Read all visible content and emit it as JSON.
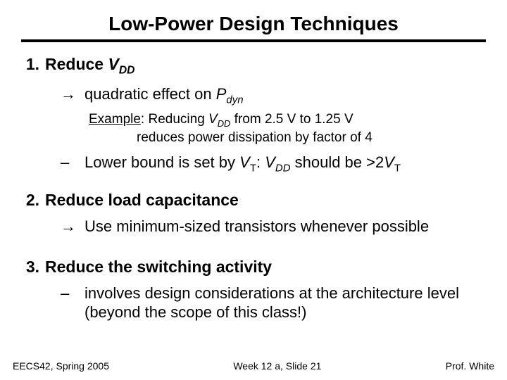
{
  "title": "Low-Power Design Techniques",
  "item1_num": "1.",
  "item1_a": "Reduce ",
  "item1_V": "V",
  "item1_DD": "DD",
  "item1_sub1_arrow": "→",
  "item1_sub1_a": "quadratic effect on ",
  "item1_sub1_P": "P",
  "item1_sub1_dyn": "dyn",
  "ex_label": "Example",
  "ex_a": ": Reducing ",
  "ex_V": "V",
  "ex_DD": "DD",
  "ex_b": " from 2.5 V to 1.25 V",
  "ex_line2": "reduces power dissipation by factor of 4",
  "item1_sub2_dash": "–",
  "item1_sub2_a": "Lower bound is set by ",
  "item1_sub2_V1": "V",
  "item1_sub2_T1": "T",
  "item1_sub2_b": ": ",
  "item1_sub2_V2": "V",
  "item1_sub2_DD": "DD",
  "item1_sub2_c": " should be >2",
  "item1_sub2_V3": "V",
  "item1_sub2_T2": "T",
  "item2_num": "2.",
  "item2_txt": "Reduce load capacitance",
  "item2_sub1_arrow": "→",
  "item2_sub1_txt": "Use minimum-sized transistors whenever possible",
  "item3_num": "3.",
  "item3_txt": "Reduce the switching activity",
  "item3_sub1_dash": "–",
  "item3_sub1_txt": "involves design considerations at the architecture level (beyond the scope of this class!)",
  "footer_left": "EECS42, Spring 2005",
  "footer_center": "Week 12 a, Slide 21",
  "footer_right": "Prof. White"
}
